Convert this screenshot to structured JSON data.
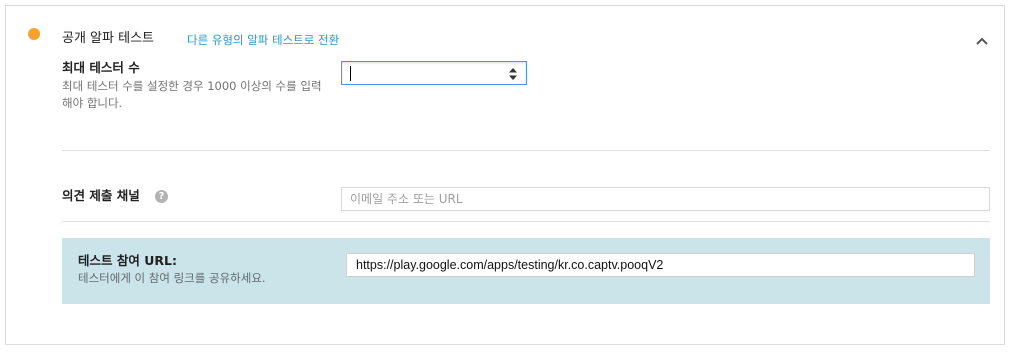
{
  "track": {
    "title": "공개 알파 테스트",
    "switch_link": "다른 유형의 알파 테스트로 전환",
    "status_color": "#f4a32f",
    "collapse_icon": "chevron-up-icon"
  },
  "max_testers": {
    "label": "최대 테스터 수",
    "help": "최대 테스터 수를 설정한 경우 1000 이상의 수를 입력해야 합니다.",
    "value": ""
  },
  "feedback": {
    "label": "의견 제출 채널",
    "help_icon": "?",
    "placeholder": "이메일 주소 또는 URL",
    "value": ""
  },
  "opt_in": {
    "label": "테스트 참여 URL:",
    "help": "테스터에게 이 참여 링크를 공유하세요.",
    "url": "https://play.google.com/apps/testing/kr.co.captv.pooqV2",
    "panel_color": "#cbe4ea"
  }
}
